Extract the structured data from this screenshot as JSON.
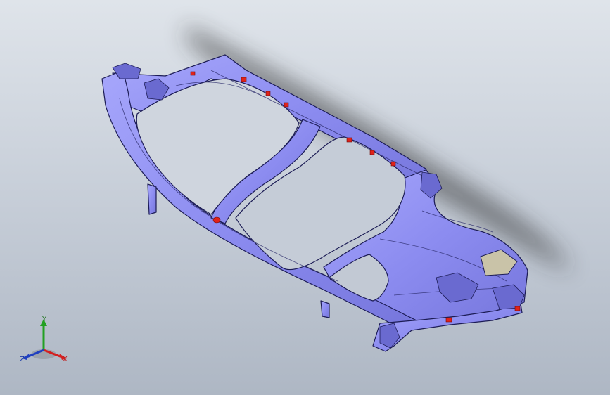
{
  "view": {
    "background_top": "#dfe4ea",
    "background_bottom": "#aeb7c4",
    "part_color": "#8f8ff2",
    "edge_color": "#1c1c55",
    "highlight_color": "#e0221a",
    "shadow_color": "#2a2a2a"
  },
  "triad": {
    "x_label": "X",
    "y_label": "Y",
    "z_label": "Z",
    "x_color": "#d42020",
    "y_color": "#22a022",
    "z_color": "#2040c0"
  }
}
